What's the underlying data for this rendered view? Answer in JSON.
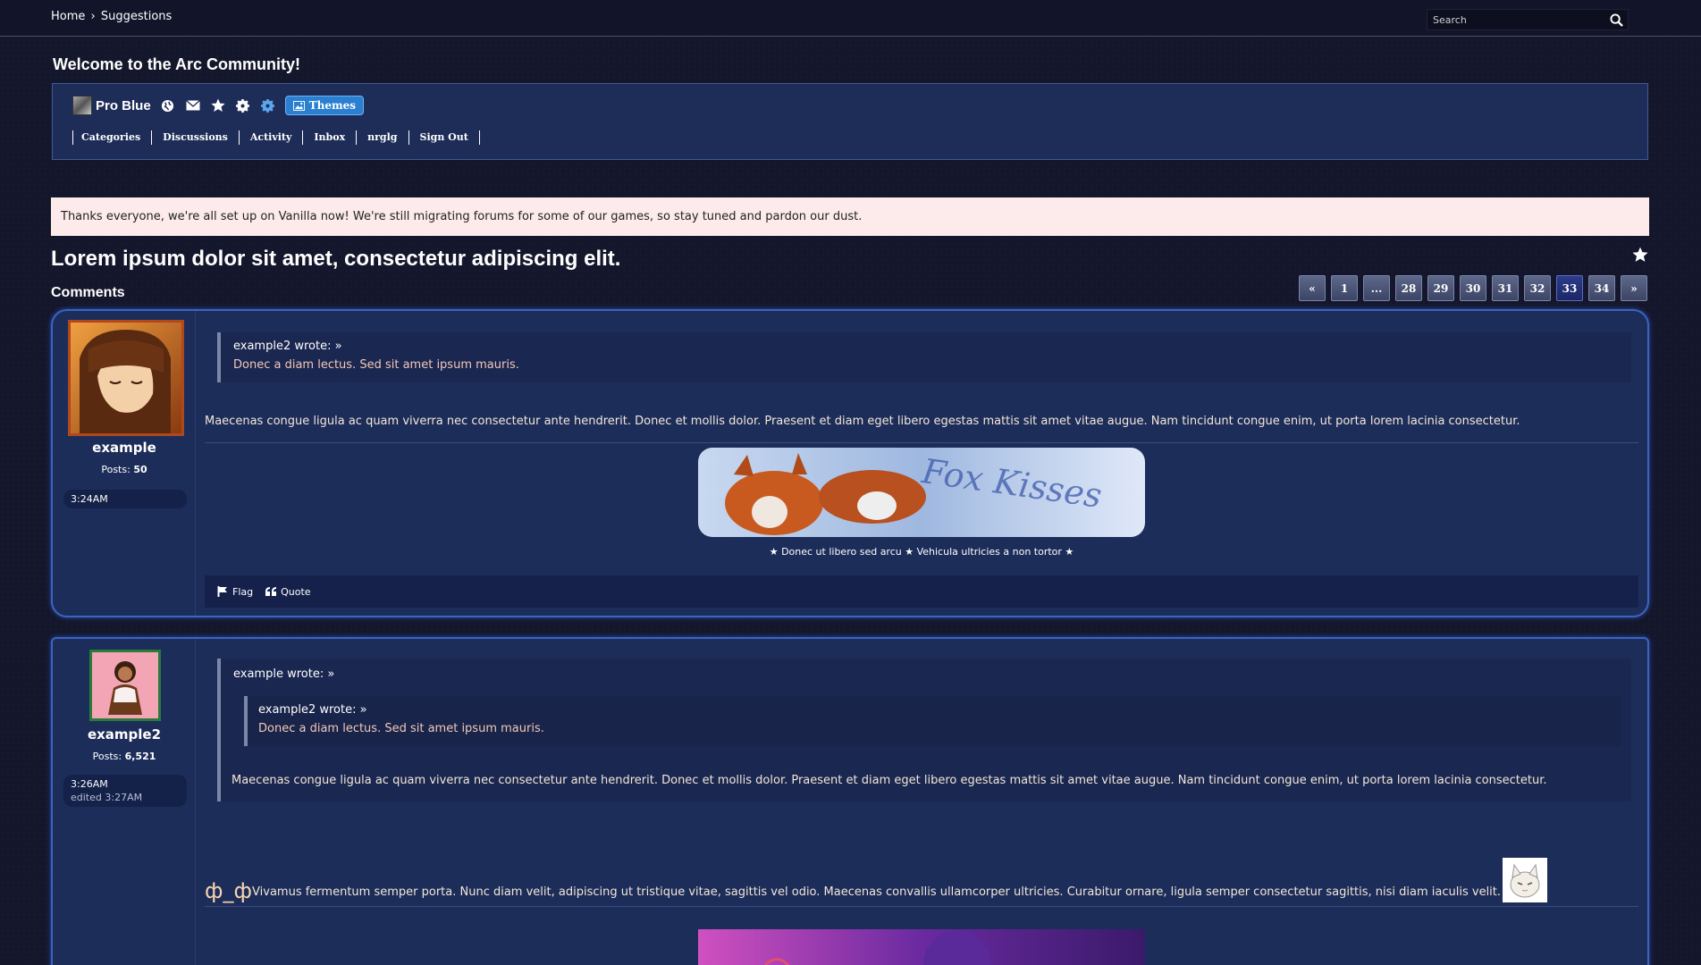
{
  "topbar": {
    "breadcrumb_home": "Home",
    "breadcrumb_sep": "›",
    "breadcrumb_current": "Suggestions",
    "search_placeholder": "Search"
  },
  "welcome": {
    "title": "Welcome to the Arc Community!",
    "username": "Pro Blue",
    "themes_label": "Themes",
    "nav": [
      "Categories",
      "Discussions",
      "Activity",
      "Inbox",
      "nrglg",
      "Sign Out"
    ]
  },
  "announcement": "Thanks everyone, we're all set up on Vanilla now! We're still migrating forums for some of our games, so stay tuned and pardon our dust.",
  "discussion": {
    "title": "Lorem ipsum dolor sit amet, consectetur adipiscing elit.",
    "comments_heading": "Comments"
  },
  "pager": {
    "prev": "«",
    "pages": [
      "1",
      "...",
      "28",
      "29",
      "30",
      "31",
      "32",
      "33",
      "34"
    ],
    "current": "33",
    "next": "»"
  },
  "comments": [
    {
      "author": "example",
      "posts_label": "Posts:",
      "posts": "50",
      "time": "3:24AM",
      "quote_head": "example2 wrote: »",
      "quote_text": "Donec a diam lectus. Sed sit amet ipsum mauris.",
      "message": "Maecenas congue ligula ac quam viverra nec consectetur ante hendrerit. Donec et mollis dolor. Praesent et diam eget libero egestas mattis sit amet vitae augue. Nam tincidunt congue enim, ut porta lorem lacinia consectetur.",
      "signature_image_text": "Fox Kisses",
      "signature_text": "★ Donec ut libero sed arcu ★ Vehicula ultricies a non tortor ★",
      "flag_label": "Flag",
      "quote_label": "Quote"
    },
    {
      "author": "example2",
      "posts_label": "Posts:",
      "posts": "6,521",
      "time": "3:26AM",
      "edited": "edited 3:27AM",
      "outer_quote_head": "example wrote: »",
      "inner_quote_head": "example2 wrote: »",
      "inner_quote_text": "Donec a diam lectus. Sed sit amet ipsum mauris.",
      "outer_quote_text": "Maecenas congue ligula ac quam viverra nec consectetur ante hendrerit. Donec et mollis dolor. Praesent et diam eget libero egestas mattis sit amet vitae augue. Nam tincidunt congue enim, ut porta lorem lacinia consectetur.",
      "emote": "ф_ф",
      "message": "Vivamus fermentum semper porta. Nunc diam velit, adipiscing ut tristique vitae, sagittis vel odio. Maecenas convallis ullamcorper ultricies. Curabitur ornare, ligula semper consectetur sagittis, nisi diam iaculis velit."
    }
  ],
  "colors": {
    "background": "#14172b",
    "panel": "#1e2d58",
    "comment_border": "#3a64c4",
    "announcement": "#fdeaea",
    "themes_button": "#2a7fd0"
  }
}
